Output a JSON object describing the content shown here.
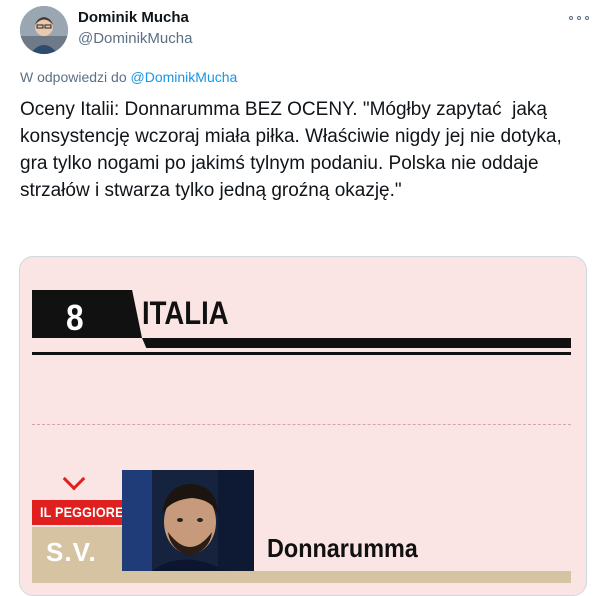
{
  "author": {
    "display_name": "Dominik Mucha",
    "handle": "@DominikMucha"
  },
  "reply": {
    "prefix": "W odpowiedzi do",
    "to": "@DominikMucha"
  },
  "tweet": {
    "text": "Oceny Italii: Donnarumma BEZ OCENY. \"Mógłby zapytać  jaką konsystencję wczoraj miała piłka. Właściwie nigdy jej nie dotyka, gra tylko nogami po jakimś tylnym podaniu. Polska nie oddaje strzałów i stwarza tylko jedną groźną okazję.\""
  },
  "media": {
    "rating_number": "8",
    "team": "ITALIA",
    "worst_label": "IL PEGGIORE",
    "grade": "S.V.",
    "player_name": "Donnarumma"
  },
  "icons": {
    "more": "more-horizontal-icon",
    "chevron": "chevron-down-icon"
  },
  "colors": {
    "link": "#1b95e0",
    "accent_red": "#e0201f",
    "card_bg": "#fbe4e4",
    "tan": "#d6c3a2"
  }
}
